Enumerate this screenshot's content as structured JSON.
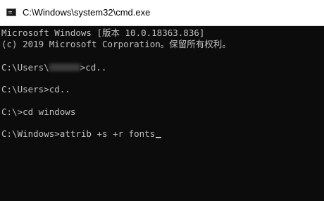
{
  "window": {
    "title": "C:\\Windows\\system32\\cmd.exe"
  },
  "console": {
    "header_line1": "Microsoft Windows [版本 10.0.18363.836]",
    "header_line2": "(c) 2019 Microsoft Corporation。保留所有权利。",
    "cmd1_prefix": "C:\\Users\\",
    "cmd1_suffix": ">cd..",
    "cmd2": "C:\\Users>cd..",
    "cmd3": "C:\\>cd windows",
    "cmd4": "C:\\Windows>attrib +s +r fonts"
  },
  "colors": {
    "background": "#0c0c0c",
    "text": "#c0c0c0",
    "titlebar": "#ffffff"
  },
  "icons": {
    "app": "cmd-app-icon"
  }
}
